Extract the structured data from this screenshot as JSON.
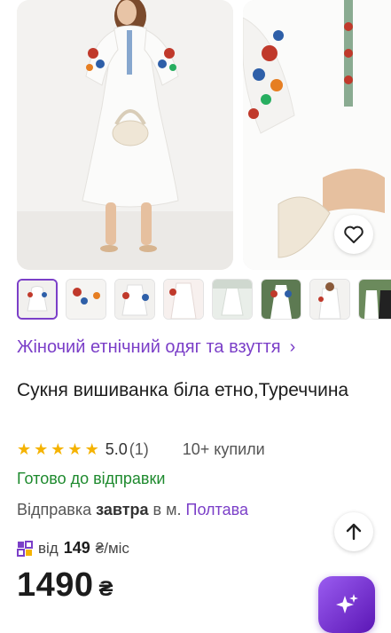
{
  "gallery": {
    "main_image": "woman in white embroidered vyshyvanka dress holding white bag",
    "second_image": "close-up of embroidered sleeve with tassels",
    "favorite_icon": "heart-outline-icon"
  },
  "thumbnails": [
    {
      "label": "thumb-1",
      "active": true
    },
    {
      "label": "thumb-2",
      "active": false
    },
    {
      "label": "thumb-3",
      "active": false
    },
    {
      "label": "thumb-4",
      "active": false
    },
    {
      "label": "thumb-5",
      "active": false
    },
    {
      "label": "thumb-6",
      "active": false
    },
    {
      "label": "thumb-7",
      "active": false
    },
    {
      "label": "thumb-8",
      "active": false
    }
  ],
  "category": {
    "label": "Жіночий етнічний одяг та взуття",
    "chevron": "›"
  },
  "product": {
    "title": "Сукня вишиванка біла етно,Туреччина"
  },
  "rating": {
    "stars": 5,
    "value": "5.0",
    "count": "(1)",
    "bought": "10+ купили"
  },
  "shipping": {
    "ready": "Готово до відправки",
    "prefix": "Відправка",
    "when": "завтра",
    "middle": "в м.",
    "city": "Полтава"
  },
  "installment": {
    "prefix": "від",
    "amount": "149",
    "suffix": "₴/міс"
  },
  "price": {
    "value": "1490",
    "currency": "₴"
  },
  "colors": {
    "accent": "#7b3fc8",
    "green": "#1e8a2e",
    "star": "#f5b301"
  }
}
